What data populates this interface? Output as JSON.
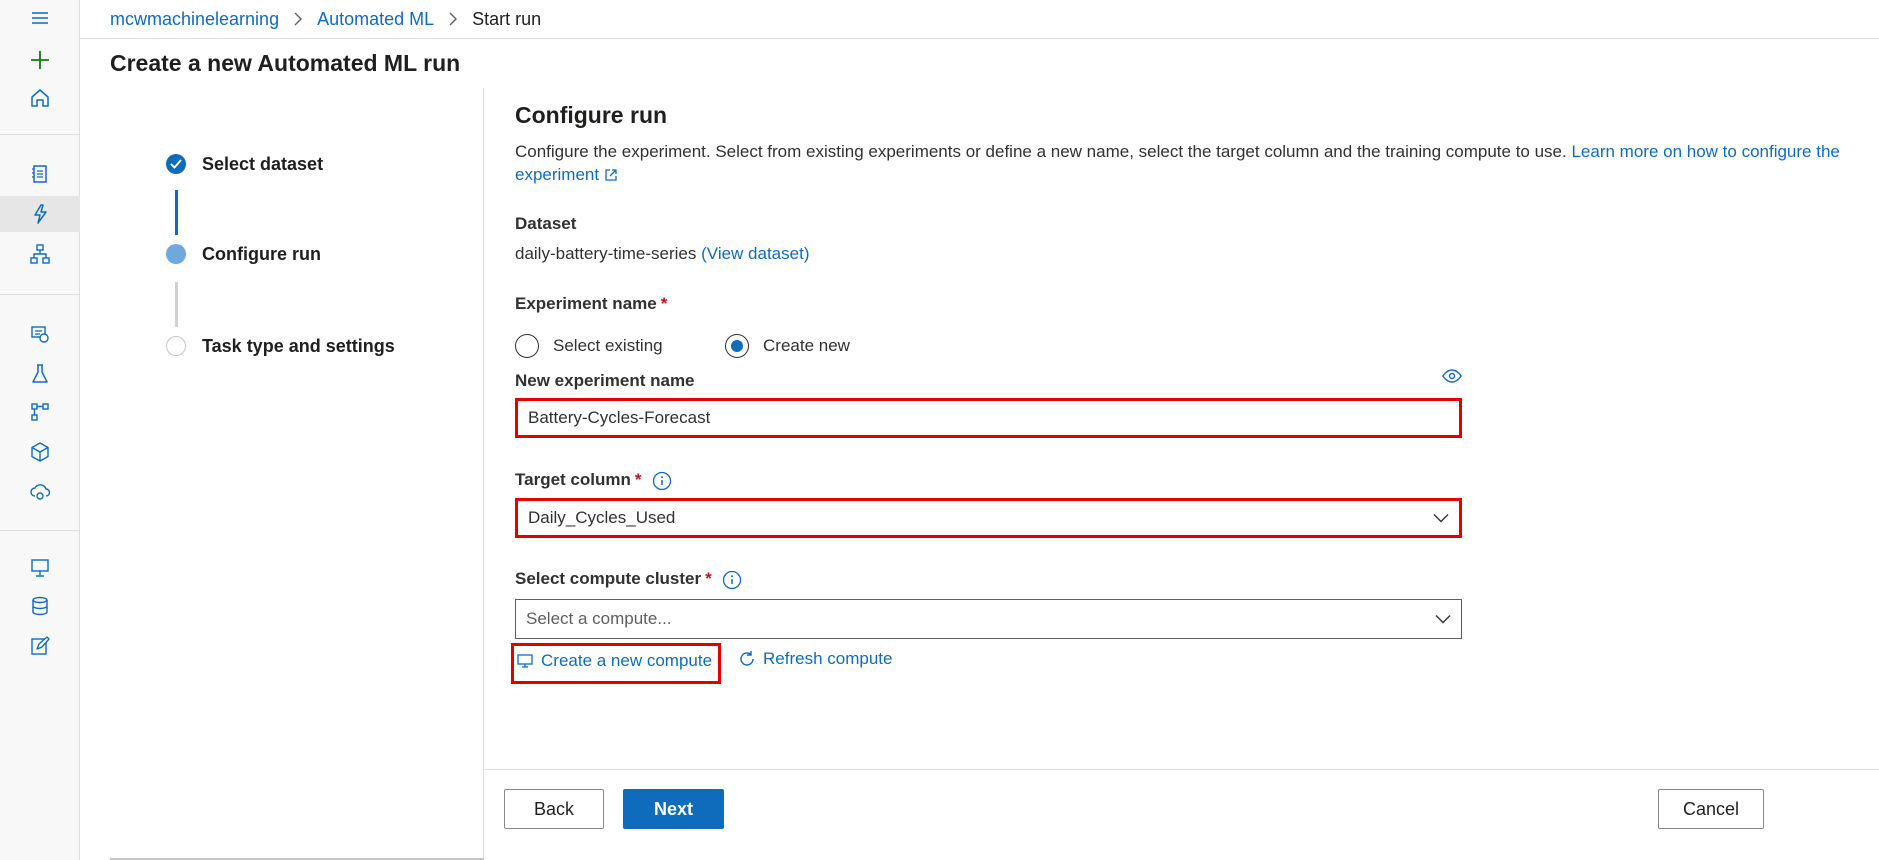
{
  "breadcrumb": {
    "workspace": "mcwmachinelearning",
    "section": "Automated ML",
    "current": "Start run"
  },
  "page_title": "Create a new Automated ML run",
  "steps": [
    {
      "label": "Select dataset",
      "state": "completed"
    },
    {
      "label": "Configure run",
      "state": "current"
    },
    {
      "label": "Task type and settings",
      "state": "pending"
    }
  ],
  "configure": {
    "title": "Configure run",
    "description": "Configure the experiment. Select from existing experiments or define a new name, select the target column and the training compute to use. ",
    "learn_more_link": "Learn more on how to configure the experiment",
    "dataset_label": "Dataset",
    "dataset_name": "daily-battery-time-series",
    "view_dataset_link": "(View dataset)",
    "experiment_name_label": "Experiment name",
    "required_mark": "*",
    "radio_select_existing": "Select existing",
    "radio_create_new": "Create new",
    "new_experiment_name_label": "New experiment name",
    "new_experiment_name_value": "Battery-Cycles-Forecast",
    "target_column_label": "Target column",
    "target_column_value": "Daily_Cycles_Used",
    "compute_label": "Select compute cluster",
    "compute_placeholder": "Select a compute...",
    "create_compute_link": "Create a new compute",
    "refresh_compute_link": "Refresh compute"
  },
  "footer": {
    "back": "Back",
    "next": "Next",
    "cancel": "Cancel"
  },
  "icons": {
    "rail": [
      "hamburger-menu-icon",
      "new-plus-icon",
      "home-icon",
      "notebooks-icon",
      "automated-ml-icon",
      "designer-icon",
      "datasets-icon",
      "experiments-icon",
      "pipelines-icon",
      "models-icon",
      "endpoints-icon",
      "compute-icon",
      "datastores-icon",
      "data-labeling-icon"
    ],
    "info": "info-icon",
    "eye": "eye-icon"
  },
  "colors": {
    "accent": "#0f6cbd",
    "highlight": "#e50000",
    "required": "#c50f1f",
    "plus": "#107c10"
  }
}
